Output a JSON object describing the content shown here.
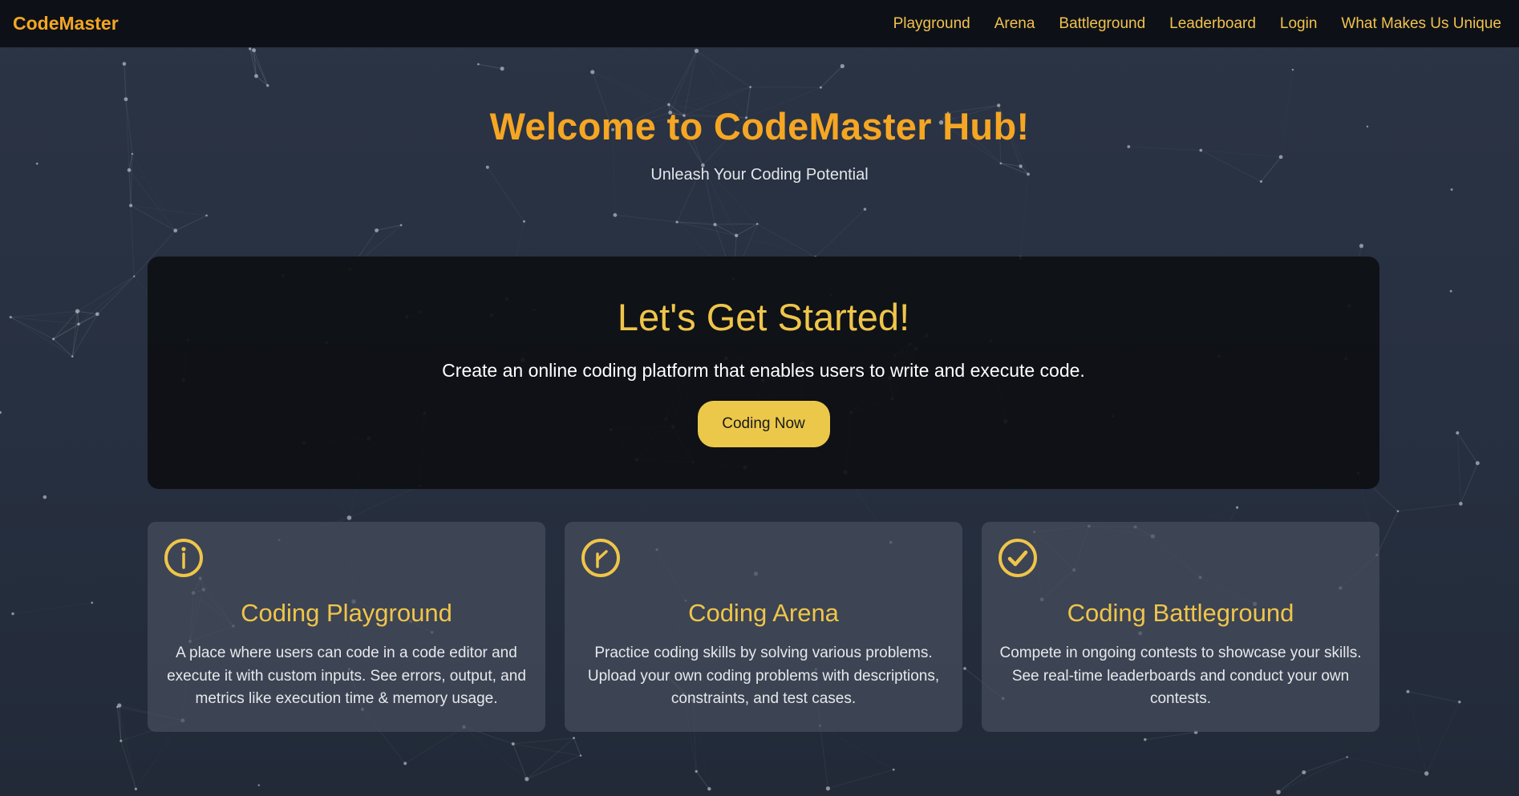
{
  "nav": {
    "brand": "CodeMaster",
    "links": [
      "Playground",
      "Arena",
      "Battleground",
      "Leaderboard",
      "Login",
      "What Makes Us Unique"
    ]
  },
  "hero": {
    "title": "Welcome to CodeMaster Hub!",
    "subtitle": "Unleash Your Coding Potential"
  },
  "start": {
    "heading": "Let's Get Started!",
    "description": "Create an online coding platform that enables users to write and execute code.",
    "button": "Coding Now"
  },
  "cards": [
    {
      "icon": "info-icon",
      "title": "Coding Playground",
      "text": "A place where users can code in a code editor and execute it with custom inputs. See errors, output, and metrics like execution time & memory usage."
    },
    {
      "icon": "clock-icon",
      "title": "Coding Arena",
      "text": "Practice coding skills by solving various problems. Upload your own coding problems with descriptions, constraints, and test cases."
    },
    {
      "icon": "check-circle-icon",
      "title": "Coding Battleground",
      "text": "Compete in ongoing contests to showcase your skills. See real-time leaderboards and conduct your own contests."
    }
  ],
  "colors": {
    "brand_orange": "#f5a623",
    "accent_yellow": "#efc54a",
    "button_yellow": "#ecc84a",
    "navbar_bg": "#0d1117",
    "page_bg": "#2b3445"
  }
}
